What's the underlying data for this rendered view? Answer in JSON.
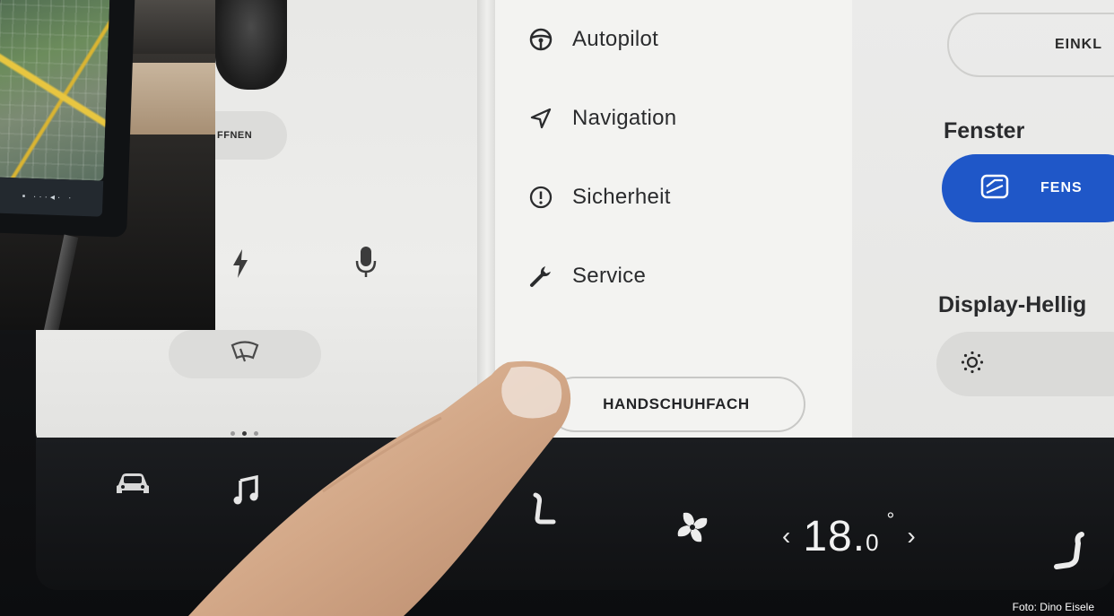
{
  "left_panel": {
    "open_button_label": "FFNEN",
    "icons": [
      "lightning-icon",
      "microphone-icon",
      "wiper-icon"
    ],
    "page_dots": 3,
    "active_page": 2
  },
  "menu": {
    "items": [
      {
        "label": "Autopilot",
        "icon": "steering-wheel-icon"
      },
      {
        "label": "Navigation",
        "icon": "navigation-arrow-icon"
      },
      {
        "label": "Sicherheit",
        "icon": "alert-circle-icon"
      },
      {
        "label": "Service",
        "icon": "wrench-icon"
      }
    ],
    "glovebox_button": "HANDSCHUHFACH"
  },
  "right_panel": {
    "top_button": "EINKL",
    "window_title": "Fenster",
    "window_button": "FENS",
    "brightness_title": "Display-Hellig",
    "accent_color": "#1f57c8"
  },
  "dock": {
    "icons": [
      "car-icon",
      "music-note-icon",
      "seat-heater-left-icon",
      "fan-icon",
      "seat-heater-right-icon"
    ],
    "temperature": {
      "value": "18.",
      "decimal": "0",
      "degree": "°",
      "left_arrow": "‹",
      "right_arrow": "›"
    }
  },
  "inset_phone": {
    "status_bar": "▪ ···◂· ·"
  },
  "credit": "Foto: Dino Eisele"
}
